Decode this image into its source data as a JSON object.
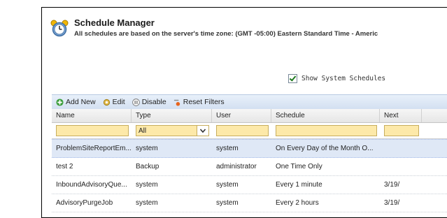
{
  "header": {
    "title": "Schedule Manager",
    "subtitle": "All schedules are based on the server's time zone: (GMT -05:00) Eastern Standard Time - Americ"
  },
  "options": {
    "show_system_label": "Show System Schedules",
    "show_system_checked": true
  },
  "toolbar": {
    "add_label": "Add New",
    "edit_label": "Edit",
    "disable_label": "Disable",
    "reset_label": "Reset Filters"
  },
  "grid": {
    "columns": [
      "Name",
      "Type",
      "User",
      "Schedule",
      "Next"
    ],
    "filters": {
      "type_value": "All"
    },
    "rows": [
      {
        "name": "ProblemSiteReportEm...",
        "type": "system",
        "user": "system",
        "schedule": "On Every Day of the Month O...",
        "next": ""
      },
      {
        "name": "test 2",
        "type": "Backup",
        "user": "administrator",
        "schedule": "One Time Only",
        "next": ""
      },
      {
        "name": "InboundAdvisoryQue...",
        "type": "system",
        "user": "system",
        "schedule": "Every 1 minute",
        "next": "3/19/"
      },
      {
        "name": "AdvisoryPurgeJob",
        "type": "system",
        "user": "system",
        "schedule": "Every 2 hours",
        "next": "3/19/"
      }
    ]
  },
  "colors": {
    "filter_bg": "#fde9a9",
    "selected_row": "#dfe8f6",
    "toolbar_bg": "#d3e0f1"
  }
}
